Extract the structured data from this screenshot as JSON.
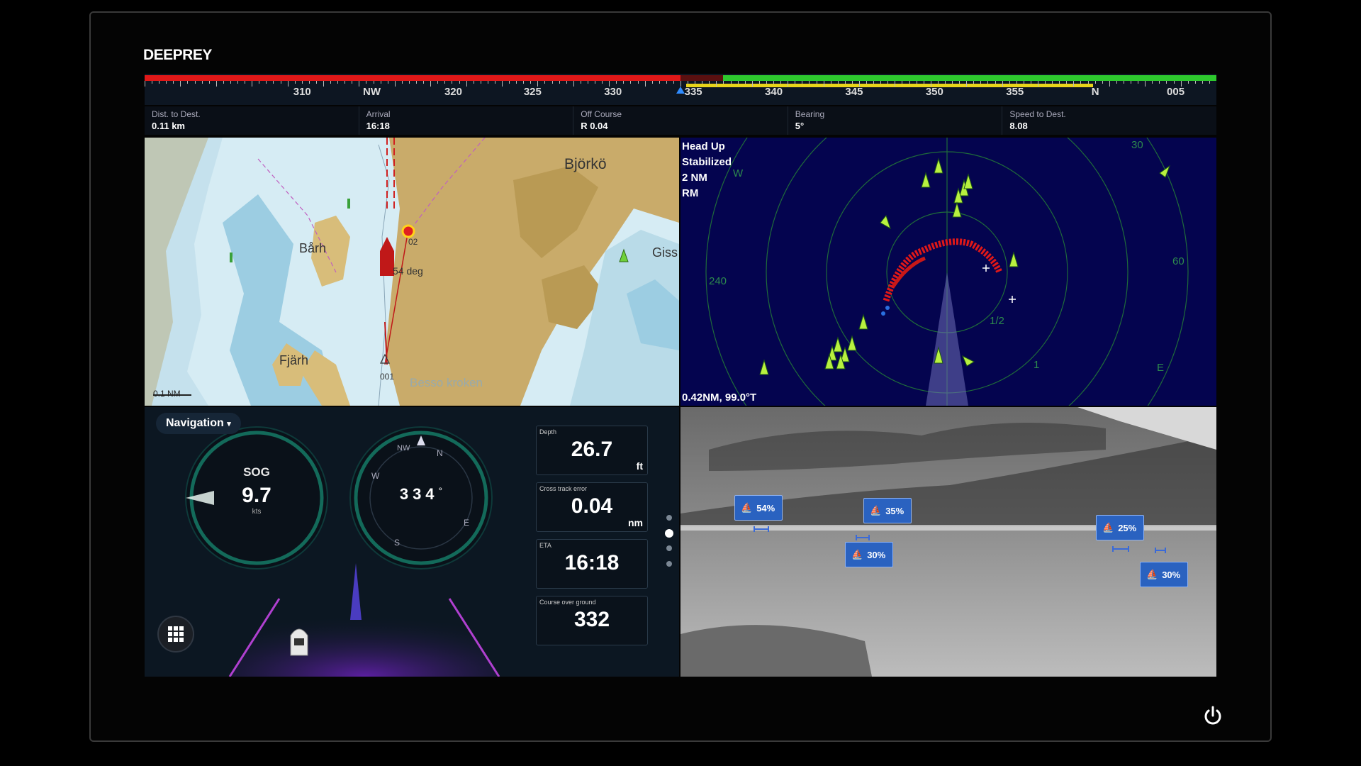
{
  "brand": {
    "logo": "DEEPREY"
  },
  "compass": {
    "labels": [
      {
        "text": "310",
        "pos": 0.147
      },
      {
        "text": "NW",
        "pos": 0.212
      },
      {
        "text": "320",
        "pos": 0.288
      },
      {
        "text": "325",
        "pos": 0.362
      },
      {
        "text": "330",
        "pos": 0.437
      },
      {
        "text": "335",
        "pos": 0.512
      },
      {
        "text": "340",
        "pos": 0.587
      },
      {
        "text": "345",
        "pos": 0.662
      },
      {
        "text": "350",
        "pos": 0.737
      },
      {
        "text": "355",
        "pos": 0.812
      },
      {
        "text": "N",
        "pos": 0.887
      },
      {
        "text": "005",
        "pos": 0.962
      }
    ],
    "colors": {
      "port": "#e01818",
      "starboard": "#2ec92e",
      "yellow": "#e8d41a",
      "marker": "#2f8cff"
    }
  },
  "info_bar": [
    {
      "label": "Dist. to Dest.",
      "value": "0.11 km"
    },
    {
      "label": "Arrival",
      "value": "16:18"
    },
    {
      "label": "Off Course",
      "value": "R 0.04"
    },
    {
      "label": "Bearing",
      "value": "5°"
    },
    {
      "label": "Speed to Dest.",
      "value": "8.08"
    }
  ],
  "chart": {
    "places": {
      "bjorko": "Björkö",
      "barh": "Bårh",
      "fjarh": "Fjärh",
      "giss": "Giss",
      "besso": "Besso kroken"
    },
    "waypoint_02": "02",
    "waypoint_001": "001",
    "heading_label": "54 deg",
    "scale": "0.1 NM"
  },
  "radar": {
    "mode_lines": [
      "Head Up",
      "Stabilized",
      "2 NM",
      "RM"
    ],
    "cursor_readout": "0.42NM, 99.0°T",
    "ring_labels": {
      "w": "W",
      "r240": "240",
      "r30": "30",
      "r60": "60",
      "half": "1/2",
      "one": "1",
      "e": "E"
    }
  },
  "navigation": {
    "dropdown": "Navigation",
    "sog": {
      "label": "SOG",
      "value": "9.7",
      "unit": "kts"
    },
    "heading": {
      "value": "334",
      "degree": "°",
      "compass_letters": {
        "nw": "NW",
        "n": "N",
        "w": "W",
        "e": "E",
        "s": "S"
      }
    },
    "data_boxes": [
      {
        "label": "Depth",
        "value": "26.7",
        "unit": "ft"
      },
      {
        "label": "Cross track error",
        "value": "0.04",
        "unit": "nm"
      },
      {
        "label": "ETA",
        "value": "16:18",
        "unit": ""
      },
      {
        "label": "Course over ground",
        "value": "332",
        "unit": ""
      }
    ],
    "pager": {
      "active_index": 1,
      "count": 4
    }
  },
  "thermal": {
    "detections": [
      {
        "confidence": "54%"
      },
      {
        "confidence": "35%"
      },
      {
        "confidence": "30%"
      },
      {
        "confidence": "25%"
      },
      {
        "confidence": "30%"
      }
    ]
  }
}
